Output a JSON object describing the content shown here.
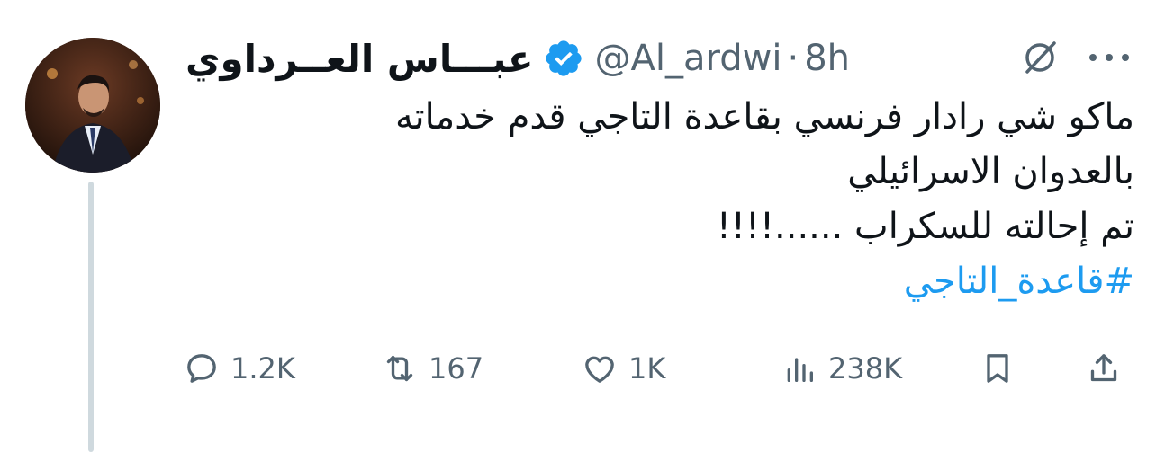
{
  "tweet": {
    "author": {
      "display_name": "عبـــاس العــرداوي",
      "handle": "@Al_ardwi",
      "verified": true,
      "avatar": "avatar-photo"
    },
    "separator": "·",
    "time": "8h",
    "lines": [
      "ماكو شي رادار فرنسي بقاعدة التاجي قدم خدماته",
      "بالعدوان الاسرائيلي",
      "تم إحالته للسكراب ......!!!!"
    ],
    "hashtag": "#قاعدة_التاجي",
    "stats": {
      "replies": "1.2K",
      "reposts": "167",
      "likes": "1K",
      "views": "238K"
    },
    "icons": {
      "header": [
        "grok-icon",
        "more-icon",
        "verified-badge-icon"
      ],
      "actions": [
        "reply-icon",
        "repost-icon",
        "like-icon",
        "views-icon",
        "bookmark-icon",
        "share-icon"
      ]
    }
  },
  "colors": {
    "text": "#0f1419",
    "secondary": "#536471",
    "accent": "#1d9bf0",
    "thread_line": "#cfd9de"
  }
}
